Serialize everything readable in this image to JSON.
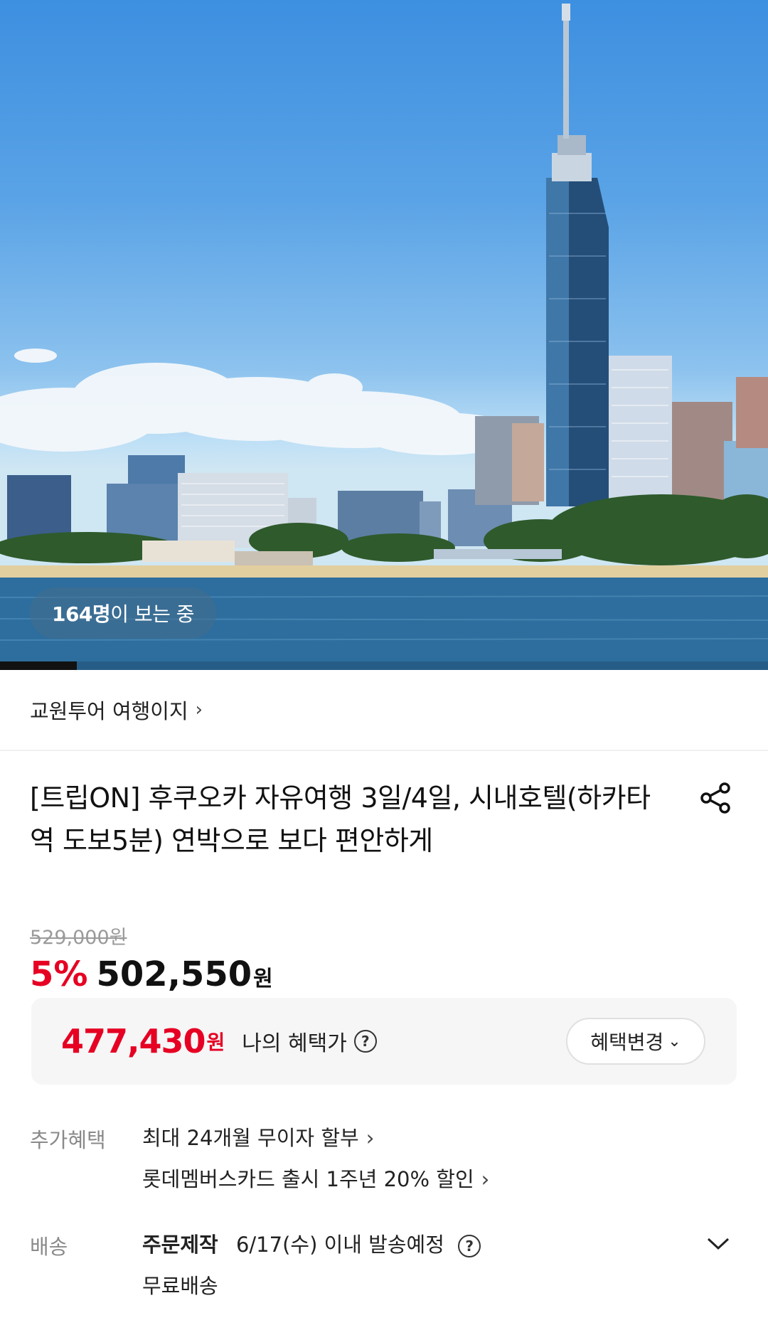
{
  "hero": {
    "viewer_count": "164명",
    "viewer_suffix": "이 보는 중",
    "gallery_progress": 0.1
  },
  "seller": {
    "name": "교원투어 여행이지"
  },
  "product": {
    "title": "[트립ON] 후쿠오카 자유여행 3일/4일, 시내호텔(하카타역 도보5분) 연박으로 보다 편안하게"
  },
  "price": {
    "original": "529,000원",
    "discount_rate": "5%",
    "sale_amount": "502,550",
    "sale_unit": "원"
  },
  "benefit": {
    "amount": "477,430",
    "unit": "원",
    "label": "나의 혜택가",
    "change_button": "혜택변경"
  },
  "extra_benefits": {
    "key": "추가혜택",
    "items": [
      "최대 24개월 무이자 할부",
      "롯데멤버스카드 출시 1주년 20% 할인"
    ]
  },
  "shipping": {
    "key": "배송",
    "type": "주문제작",
    "date_text": "6/17(수) 이내 발송예정",
    "fee": "무료배송"
  },
  "colors": {
    "accent_red": "#e60023",
    "text_dark": "#111111",
    "text_gray": "#8a8a8a"
  }
}
